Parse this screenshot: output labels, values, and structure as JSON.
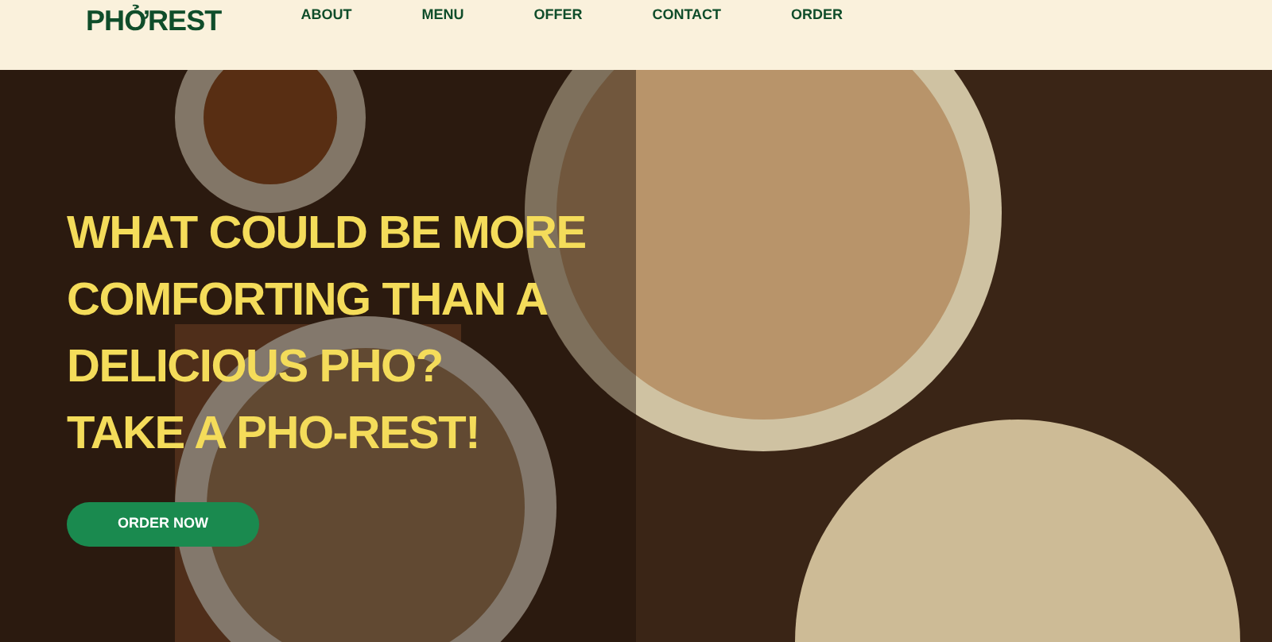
{
  "header": {
    "logo": "PHỞREST",
    "nav": [
      {
        "label": "ABOUT"
      },
      {
        "label": "MENU"
      },
      {
        "label": "OFFER"
      },
      {
        "label": "CONTACT"
      },
      {
        "label": "ORDER"
      }
    ]
  },
  "hero": {
    "heading": [
      "WHAT COULD BE MORE COMFORTING THAN A DELICIOUS PHO?",
      "TAKE A PHO-REST!"
    ],
    "button": "ORDER NOW"
  }
}
